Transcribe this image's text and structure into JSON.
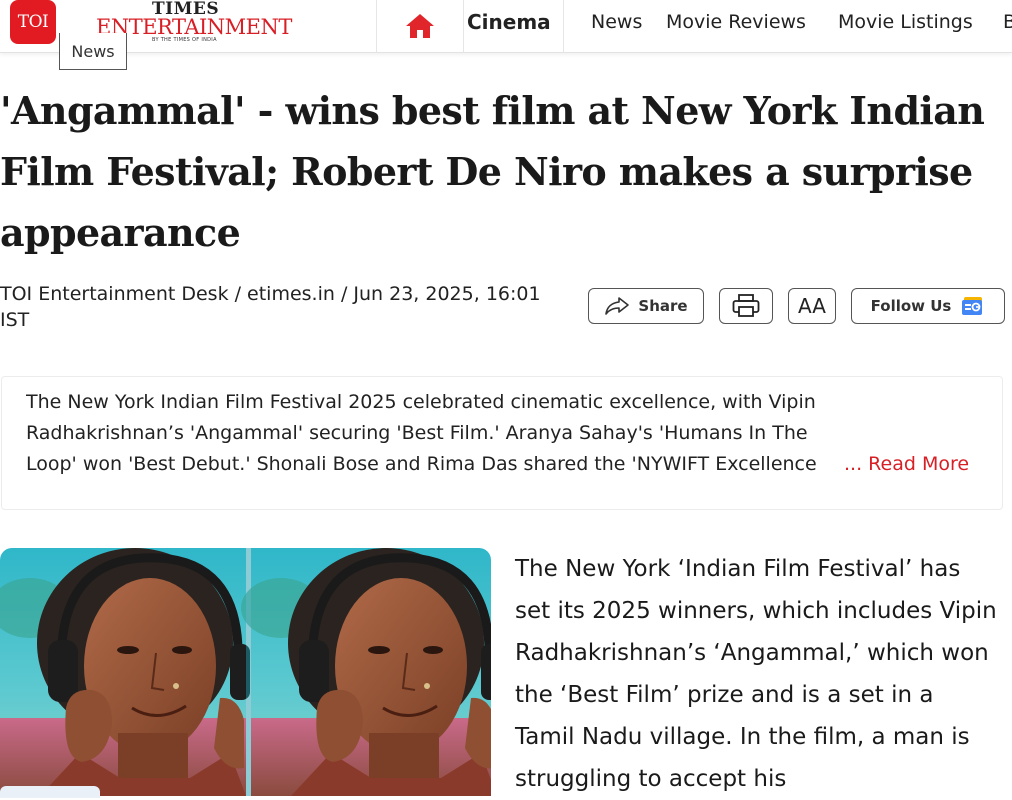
{
  "header": {
    "toi_logo": "TOI",
    "ent_logo_times": "TIMES",
    "ent_logo_word": "ENTERTAINMENT",
    "ent_logo_tagline": "BY THE TIMES OF INDIA",
    "section_tab": "News",
    "nav": {
      "home_icon": "home-icon",
      "cinema": "Cinema",
      "links": [
        "News",
        "Movie Reviews",
        "Movie Listings",
        "B"
      ]
    }
  },
  "article": {
    "title": "'Angammal' - wins best film at New York Indian Film Festival; Robert De Niro makes a surprise appearance",
    "byline": "TOI Entertainment Desk / etimes.in / Jun 23, 2025, 16:01 IST",
    "actions": {
      "share": "Share",
      "print_icon": "printer-icon",
      "font_size": "AA",
      "follow": "Follow Us"
    },
    "summary": "The New York Indian Film Festival 2025 celebrated cinematic excellence, with Vipin Radhakrishnan’s 'Angammal' securing 'Best Film.' Aranya Sahay's 'Humans In The Loop' won 'Best Debut.' Shonali Bose and Rima Das shared the 'NYWIFT Excellence",
    "read_more": "... Read More",
    "body": "The New York ‘Indian Film Festival’ has set its 2025 winners, which includes Vipin Radhakrishnan’s ‘Angammal,’ which won the ‘Best Film’ prize and is a set in a Tamil Nadu village. In the film, a man is struggling to accept his"
  },
  "colors": {
    "brand_red": "#e21b22",
    "link_red": "#d81f26",
    "text": "#1a1a1a"
  }
}
